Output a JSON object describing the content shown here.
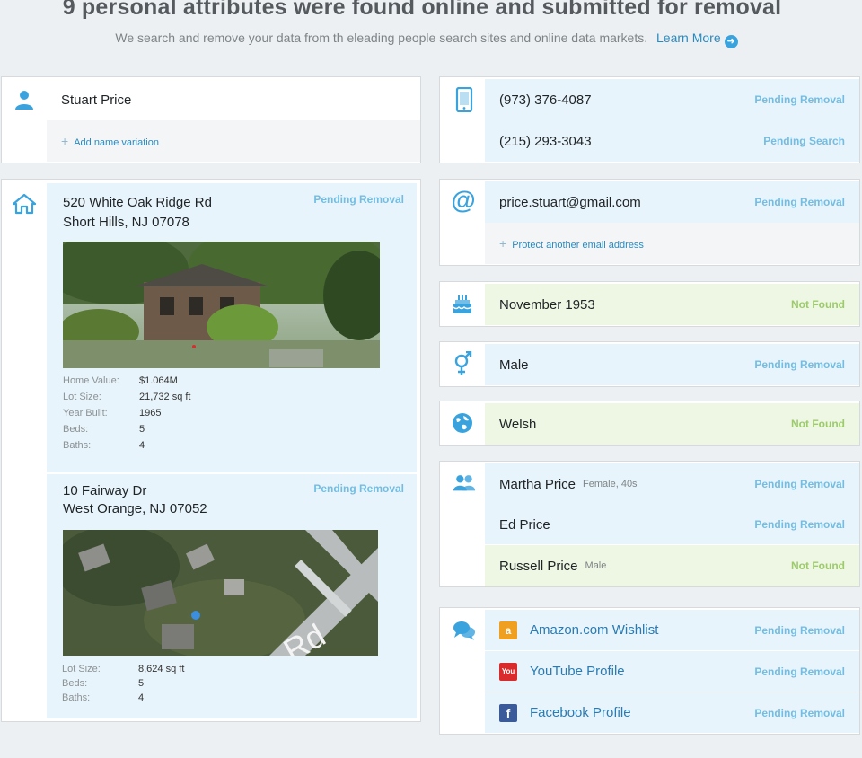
{
  "header": {
    "title": "9 personal attributes were found online and submitted for removal",
    "subtitle": "We search and remove your data from th eleading people search sites and online data markets.",
    "learn_more": "Learn More"
  },
  "name_card": {
    "icon": "person-icon",
    "name": "Stuart Price",
    "add_variation": "Add name variation"
  },
  "address_card": {
    "icon": "house-icon",
    "addresses": [
      {
        "line1": "520 White Oak Ridge Rd",
        "line2": "Short Hills, NJ 07078",
        "status": "Pending Removal",
        "facts": [
          {
            "k": "Home Value:",
            "v": "$1.064M"
          },
          {
            "k": "Lot Size:",
            "v": "21,732 sq ft"
          },
          {
            "k": "Year Built:",
            "v": "1965"
          },
          {
            "k": "Beds:",
            "v": "5"
          },
          {
            "k": "Baths:",
            "v": "4"
          }
        ]
      },
      {
        "line1": "10 Fairway Dr",
        "line2": "West Orange, NJ 07052",
        "status": "Pending Removal",
        "map_text": "Rd",
        "facts": [
          {
            "k": "Lot Size:",
            "v": "8,624 sq ft"
          },
          {
            "k": "Beds:",
            "v": "5"
          },
          {
            "k": "Baths:",
            "v": "4"
          }
        ]
      }
    ]
  },
  "phone_card": {
    "icon": "phone-icon",
    "items": [
      {
        "value": "(973) 376-4087",
        "status": "Pending Removal"
      },
      {
        "value": "(215) 293-3043",
        "status": "Pending Search"
      }
    ]
  },
  "email_card": {
    "icon": "at-icon",
    "items": [
      {
        "value": "price.stuart@gmail.com",
        "status": "Pending Removal"
      }
    ],
    "add_email": "Protect another email address"
  },
  "birthday_card": {
    "icon": "cake-icon",
    "value": "November 1953",
    "status": "Not Found"
  },
  "gender_card": {
    "icon": "gender-icon",
    "value": "Male",
    "status": "Pending Removal"
  },
  "ethnicity_card": {
    "icon": "globe-icon",
    "value": "Welsh",
    "status": "Not Found"
  },
  "relatives_card": {
    "icon": "people-icon",
    "items": [
      {
        "name": "Martha Price",
        "detail": "Female, 40s",
        "status": "Pending Removal"
      },
      {
        "name": "Ed Price",
        "detail": "",
        "status": "Pending Removal"
      },
      {
        "name": "Russell Price",
        "detail": "Male",
        "status": "Not Found"
      }
    ]
  },
  "social_card": {
    "icon": "chat-icon",
    "items": [
      {
        "label": "Amazon.com Wishlist",
        "icon": "amazon-icon",
        "glyph": "a",
        "color": "#f0a020",
        "status": "Pending Removal"
      },
      {
        "label": "YouTube Profile",
        "icon": "youtube-icon",
        "glyph": "You",
        "color": "#d92b2b",
        "status": "Pending Removal"
      },
      {
        "label": "Facebook Profile",
        "icon": "facebook-icon",
        "glyph": "f",
        "color": "#3b5a9a",
        "status": "Pending Removal"
      }
    ]
  }
}
